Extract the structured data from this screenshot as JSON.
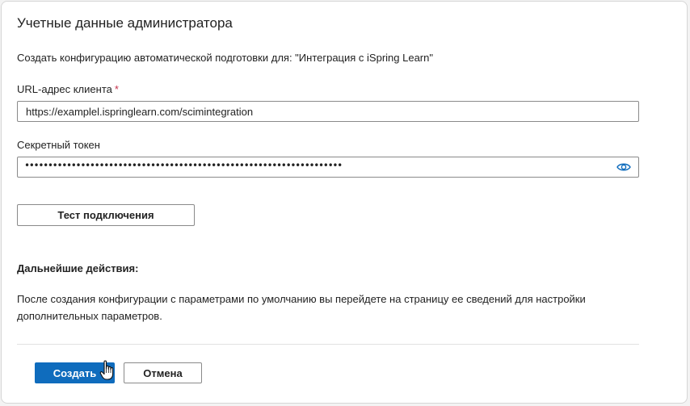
{
  "dialog": {
    "title": "Учетные данные администратора",
    "subtitle": "Создать конфигурацию автоматической подготовки для: \"Интеграция с iSpring Learn\""
  },
  "form": {
    "tenant_url": {
      "label": "URL-адрес клиента",
      "required_marker": "*",
      "value": "https://examplel.ispringlearn.com/scimintegration"
    },
    "secret_token": {
      "label": "Секретный токен",
      "masked_value": "••••••••••••••••••••••••••••••••••••••••••••••••••••••••••••••••••••",
      "reveal_icon": "eye-icon"
    },
    "test_button_label": "Тест подключения"
  },
  "next_steps": {
    "title": "Дальнейшие действия:",
    "text": "После создания конфигурации с параметрами по умолчанию вы перейдете на страницу ее сведений для настройки дополнительных параметров."
  },
  "footer": {
    "create_label": "Создать",
    "cancel_label": "Отмена"
  },
  "colors": {
    "primary": "#0f6cbd",
    "required": "#c4314b"
  }
}
